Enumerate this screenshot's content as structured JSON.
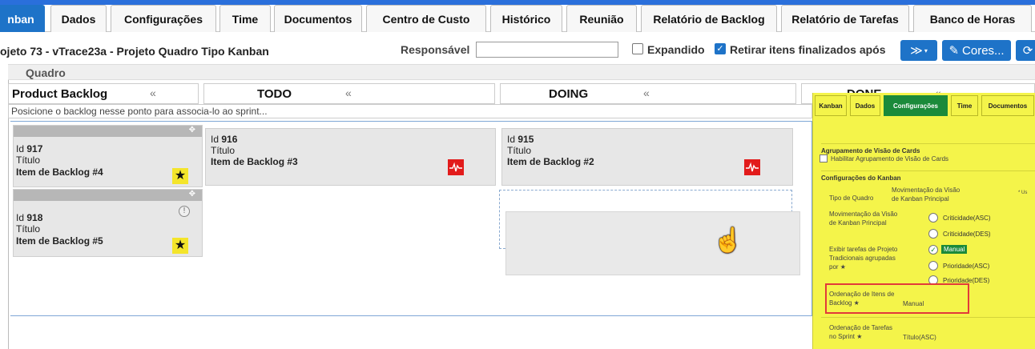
{
  "tabs": [
    {
      "label": "nban",
      "active": true
    },
    {
      "label": "Dados"
    },
    {
      "label": "Configurações"
    },
    {
      "label": "Time"
    },
    {
      "label": "Documentos"
    },
    {
      "label": "Centro de Custo"
    },
    {
      "label": "Histórico"
    },
    {
      "label": "Reunião"
    },
    {
      "label": "Relatório de Backlog"
    },
    {
      "label": "Relatório de Tarefas"
    },
    {
      "label": "Banco de Horas"
    }
  ],
  "project_title": "ojeto 73 - vTrace23a - Projeto Quadro Tipo Kanban",
  "filters": {
    "responsavel_label": "Responsável",
    "responsavel_value": "",
    "expandido_label": "Expandido",
    "expandido_checked": false,
    "retirar_label": "Retirar itens finalizados após",
    "retirar_checked": true,
    "more_button": "≫",
    "cores_button": "Cores...",
    "refresh_icon": "refresh-icon"
  },
  "quadro_label": "Quadro",
  "columns": [
    {
      "title": "Product Backlog",
      "collapse": "«"
    },
    {
      "title": "TODO",
      "collapse": "«"
    },
    {
      "title": "DOING",
      "collapse": "«"
    },
    {
      "title": "DONE",
      "collapse": "«"
    }
  ],
  "backlog_hint": "Posicione o backlog nesse ponto para associa-lo ao sprint...",
  "cards": [
    {
      "id_label": "Id",
      "id": "917",
      "title_label": "Título",
      "title": "Item de Backlog #4",
      "badge": "★"
    },
    {
      "id_label": "Id",
      "id": "918",
      "title_label": "Título",
      "title": "Item de Backlog #5",
      "badge": "★",
      "info": "!"
    },
    {
      "id_label": "Id",
      "id": "916",
      "title_label": "Título",
      "title": "Item de Backlog #3",
      "badge": "pulse-icon"
    },
    {
      "id_label": "Id",
      "id": "915",
      "title_label": "Título",
      "title": "Item de Backlog #2",
      "badge": "pulse-icon"
    }
  ],
  "overlay": {
    "tabs": [
      "Kanban",
      "Dados",
      "Configurações",
      "Time",
      "Documentos"
    ],
    "active_tab": "Configurações",
    "group_section": "Agrupamento de Visão de Cards",
    "group_checkbox_label": "Habilitar Agrupamento de Visão de Cards",
    "kanban_section": "Configurações do Kanban",
    "tipo_quadro_label": "Tipo de Quadro",
    "tipo_quadro_hint": "* Us",
    "movimentacao_label": "Movimentação da Visão de Kanban Principal",
    "exibir_label": "Exibir tarefas de Projeto Tradicionais agrupadas por ★",
    "options": [
      "Criticidade(ASC)",
      "Criticidade(DES)",
      "Manual",
      "Prioridade(ASC)",
      "Prioridade(DES)"
    ],
    "selected_option": "Manual",
    "ordenacao_itens_label": "Ordenação de Itens de Backlog ★",
    "ordenacao_itens_value": "Manual",
    "ordenacao_tarefas_label": "Ordenação de Tarefas no Sprint ★",
    "ordenacao_tarefas_value": "Título(ASC)"
  },
  "colors": {
    "accent": "#1e73c8",
    "overlay_bg": "#f4f44a",
    "overlay_active": "#1b8a3a",
    "star_bg": "#f4e52b",
    "pulse_bg": "#e21b1b",
    "highlight_border": "#e23a3a"
  }
}
